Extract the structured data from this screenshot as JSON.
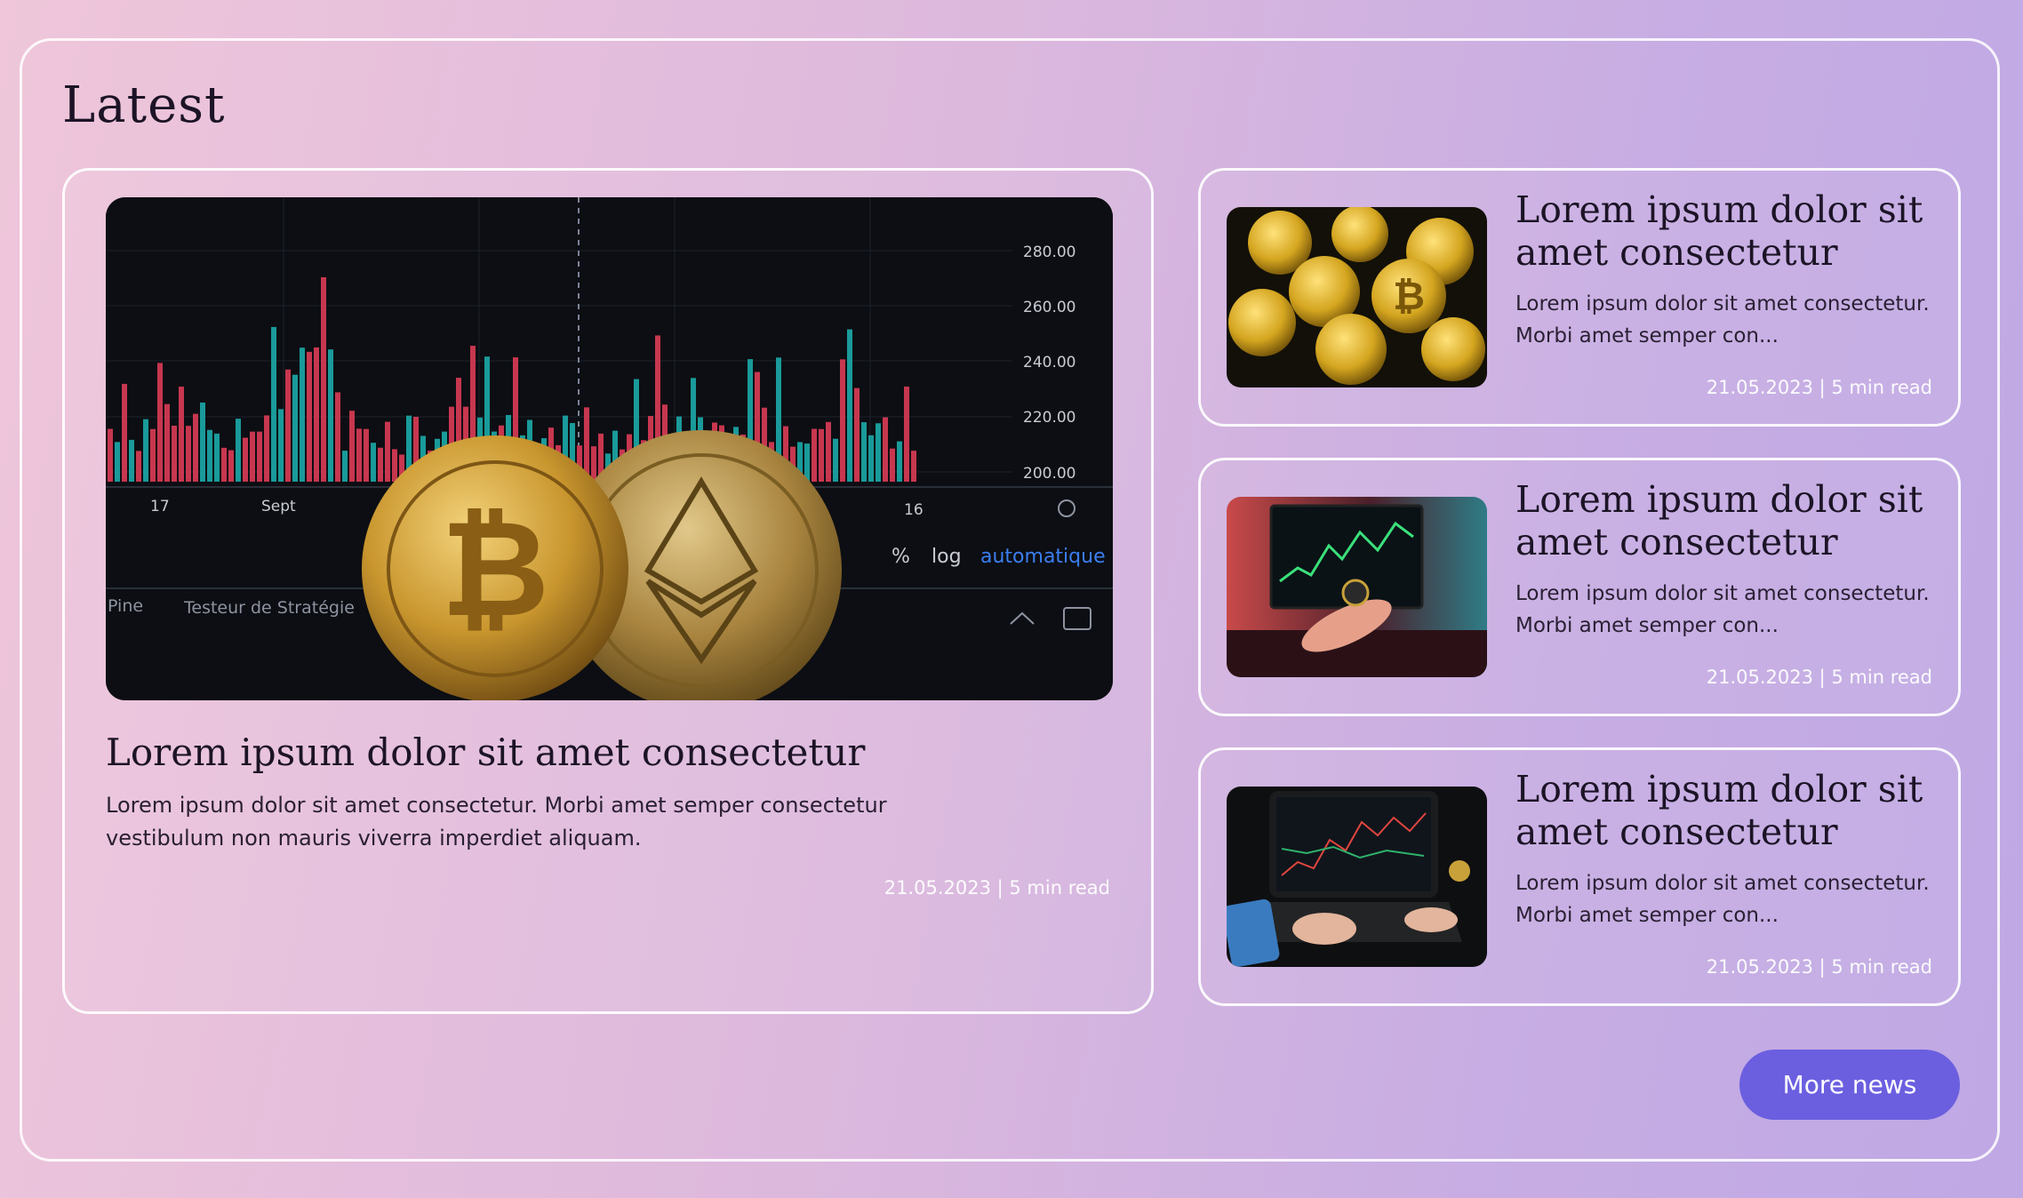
{
  "section": {
    "title": "Latest"
  },
  "featured": {
    "title": "Lorem ipsum dolor sit amet consectetur",
    "excerpt": "Lorem ipsum dolor sit amet consectetur. Morbi amet semper consectetur vestibulum non mauris viverra imperdiet aliquam.",
    "meta": "21.05.2023 | 5 min read",
    "image": {
      "price_labels": [
        "280.00",
        "260.00",
        "240.00",
        "220.00",
        "200.00"
      ],
      "date_labels": [
        "17",
        "Sept",
        "16"
      ],
      "toolbar": {
        "percent": "%",
        "log": "log",
        "auto": "automatique"
      },
      "tab_label": "Testeur de Stratégie",
      "tab_label_left": "Pine"
    }
  },
  "side_articles": [
    {
      "title": "Lorem ipsum dolor sit amet consectetur",
      "excerpt": "Lorem ipsum dolor sit amet consectetur. Morbi amet semper con...",
      "meta": "21.05.2023 | 5 min read",
      "image": "crypto-coins-image"
    },
    {
      "title": "Lorem ipsum dolor sit amet consectetur",
      "excerpt": "Lorem ipsum dolor sit amet consectetur. Morbi amet semper con...",
      "meta": "21.05.2023 | 5 min read",
      "image": "trading-monitor-image"
    },
    {
      "title": "Lorem ipsum dolor sit amet consectetur",
      "excerpt": "Lorem ipsum dolor sit amet consectetur. Morbi amet semper con...",
      "meta": "21.05.2023 | 5 min read",
      "image": "tablet-trading-image"
    }
  ],
  "more_button": {
    "label": "More news"
  },
  "colors": {
    "accent": "#6b5fe0",
    "bar_up": "#1a9a9a",
    "bar_down": "#c7374f"
  }
}
